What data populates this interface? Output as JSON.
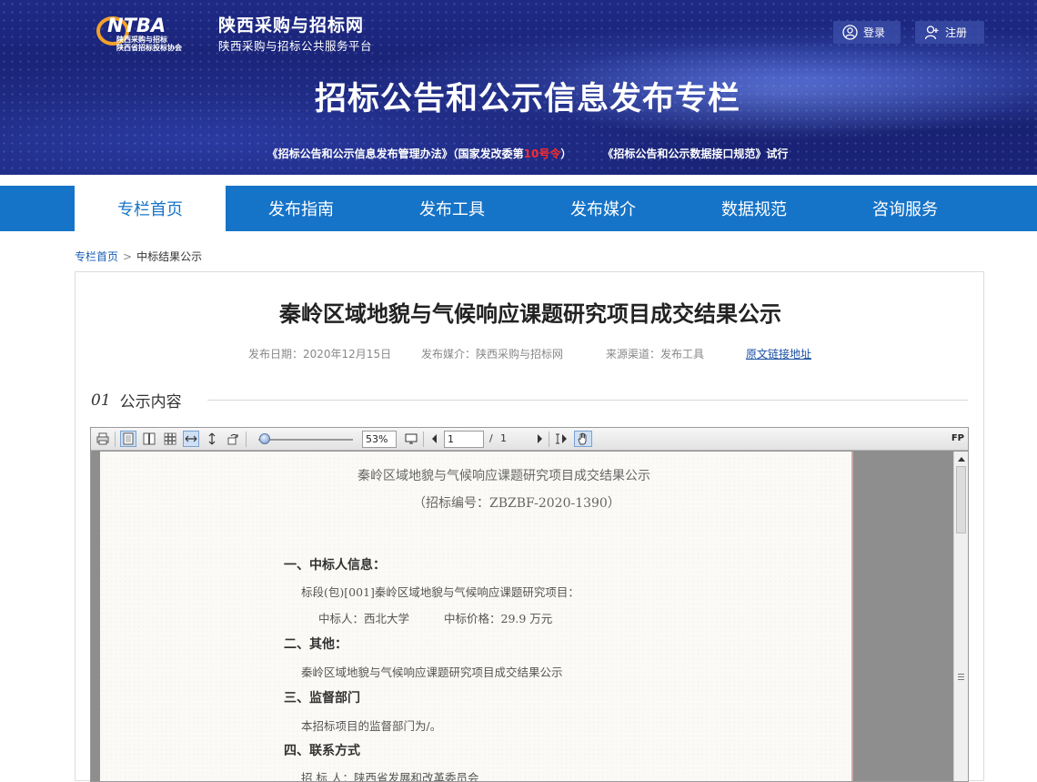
{
  "header": {
    "logo_text": "NTBA",
    "logo_caption_1": "陕西采购与招标",
    "logo_caption_2": "陕西省招标投标协会",
    "site_name": "陕西采购与招标网",
    "site_subtitle": "陕西采购与招标公共服务平台",
    "login_label": "登录",
    "register_label": "注册",
    "banner_title": "招标公告和公示信息发布专栏",
    "policy_1_pre": "《招标公告和公示信息发布管理办法》（国家发改委第",
    "policy_1_red": "10号令",
    "policy_1_post": "）",
    "policy_2": "《招标公告和公示数据接口规范》试行",
    "colors": {
      "banner": "#1b2577",
      "nav": "#1674c8",
      "highlight": "#ff2a2a"
    }
  },
  "nav": {
    "items": [
      {
        "label": "专栏首页",
        "active": true
      },
      {
        "label": "发布指南",
        "active": false
      },
      {
        "label": "发布工具",
        "active": false
      },
      {
        "label": "发布媒介",
        "active": false
      },
      {
        "label": "数据规范",
        "active": false
      },
      {
        "label": "咨询服务",
        "active": false
      }
    ]
  },
  "breadcrumb": {
    "home": "专栏首页",
    "separator": ">",
    "current": "中标结果公示"
  },
  "announcement": {
    "title": "秦岭区域地貌与气候响应课题研究项目成交结果公示",
    "publish_date": "发布日期：2020年12月15日",
    "publish_media": "发布媒介：陕西采购与招标网",
    "source_channel": "来源渠道：发布工具",
    "original_link": "原文链接地址",
    "section_num": "01",
    "section_label": "公示内容"
  },
  "viewer": {
    "zoom": "53%",
    "page_current": "1",
    "page_sep": "/",
    "page_total": "1",
    "fp_label": "FP",
    "toolbar_icons": [
      "print-icon",
      "single-page-icon",
      "two-page-icon",
      "thumbnails-icon",
      "fit-width-icon",
      "fit-height-icon",
      "rotate-icon",
      "zoom-slider",
      "fullscreen-icon",
      "prev-page-icon",
      "next-page-icon",
      "text-select-icon",
      "hand-tool-icon"
    ]
  },
  "document": {
    "title": "秦岭区域地貌与气候响应课题研究项目成交结果公示",
    "code": "（招标编号：ZBZBF-2020-1390）",
    "h1": "一、中标人信息：",
    "p1": "标段(包)[001]秦岭区域地貌与气候响应课题研究项目：",
    "winner": "中标人：西北大学",
    "price": "中标价格：29.9 万元",
    "h2": "二、其他：",
    "p2": "秦岭区域地貌与气候响应课题研究项目成交结果公示",
    "h3": "三、监督部门",
    "p3": "本招标项目的监督部门为/。",
    "h4": "四、联系方式",
    "p4": "招 标 人：陕西省发展和改革委员会"
  }
}
